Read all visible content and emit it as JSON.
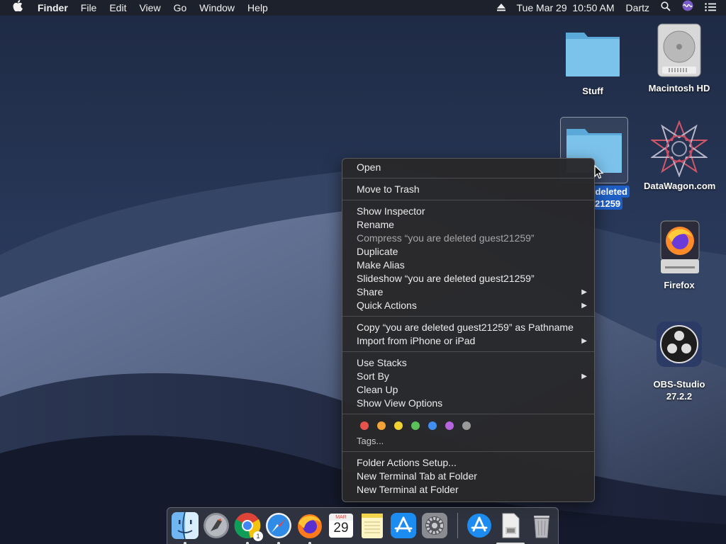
{
  "menubar": {
    "apple": "",
    "app_name": "Finder",
    "menus": [
      "File",
      "Edit",
      "View",
      "Go",
      "Window",
      "Help"
    ],
    "datetime": "Tue Mar 29  10:50 AM",
    "user": "Dartz"
  },
  "desktop_icons": {
    "stuff": "Stuff",
    "macintosh_hd": "Macintosh HD",
    "selected_folder_line1": "deleted",
    "selected_folder_line2": "21259",
    "datawagon": "DataWagon.com",
    "firefox": "Firefox",
    "obs": "OBS-Studio 27.2.2"
  },
  "context_menu": {
    "open": "Open",
    "move_to_trash": "Move to Trash",
    "show_inspector": "Show Inspector",
    "rename": "Rename",
    "compress": "Compress “you are deleted guest21259”",
    "duplicate": "Duplicate",
    "make_alias": "Make Alias",
    "slideshow": "Slideshow “you are deleted guest21259”",
    "share": "Share",
    "quick_actions": "Quick Actions",
    "copy_pathname": "Copy “you are deleted guest21259” as Pathname",
    "import_iphone": "Import from iPhone or iPad",
    "use_stacks": "Use Stacks",
    "sort_by": "Sort By",
    "clean_up": "Clean Up",
    "show_view_options": "Show View Options",
    "tags_label": "Tags...",
    "tag_colors": [
      "#e5534b",
      "#f4a338",
      "#f0d232",
      "#5ac05a",
      "#3f8ef0",
      "#b764e0",
      "#9a9a9a"
    ],
    "folder_actions": "Folder Actions Setup...",
    "new_terminal_tab": "New Terminal Tab at Folder",
    "new_terminal": "New Terminal at Folder"
  },
  "dock": {
    "calendar_month": "MAR",
    "calendar_day": "29",
    "chrome_badge": "1"
  }
}
